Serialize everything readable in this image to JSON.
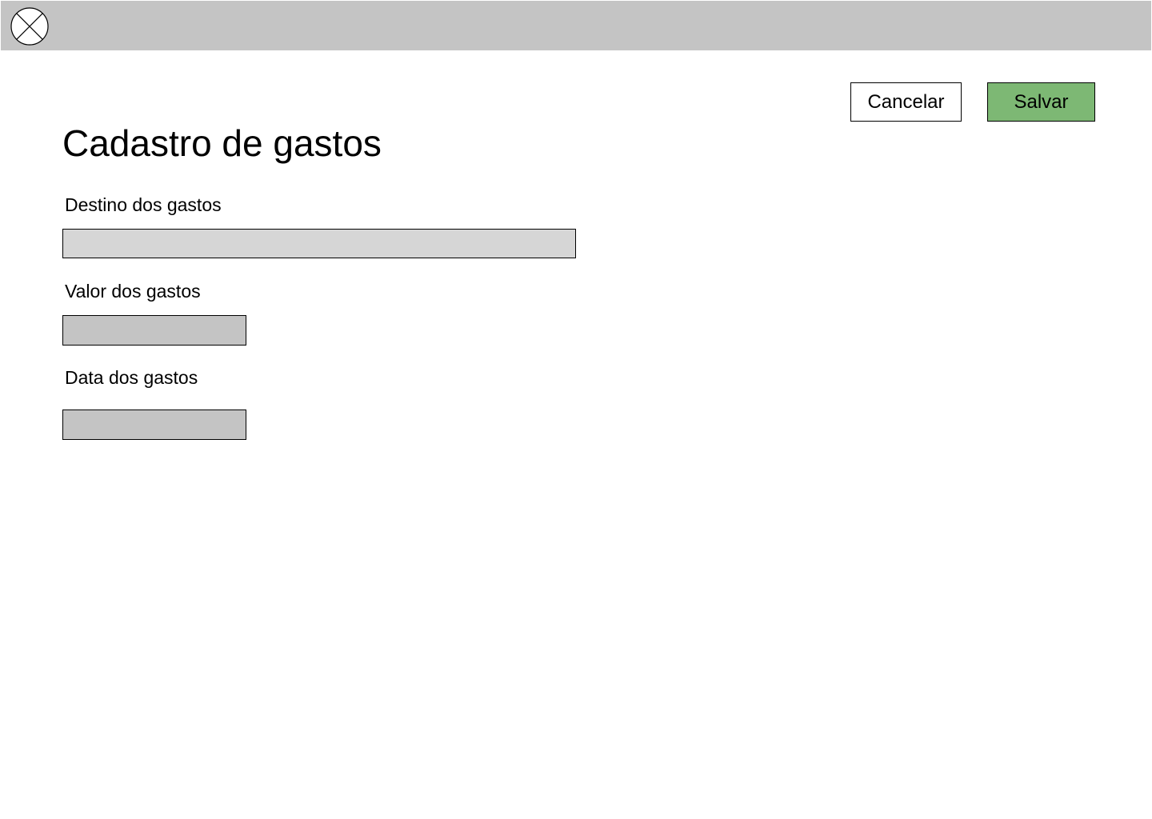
{
  "header": {
    "logo_icon": "circle-x-placeholder-icon",
    "background_color": "#c4c4c4"
  },
  "actions": {
    "cancel_label": "Cancelar",
    "save_label": "Salvar",
    "save_color": "#7db874"
  },
  "form": {
    "title": "Cadastro de gastos",
    "fields": [
      {
        "label": "Destino dos gastos",
        "value": ""
      },
      {
        "label": "Valor dos gastos",
        "value": ""
      },
      {
        "label": "Data dos gastos",
        "value": ""
      }
    ]
  }
}
